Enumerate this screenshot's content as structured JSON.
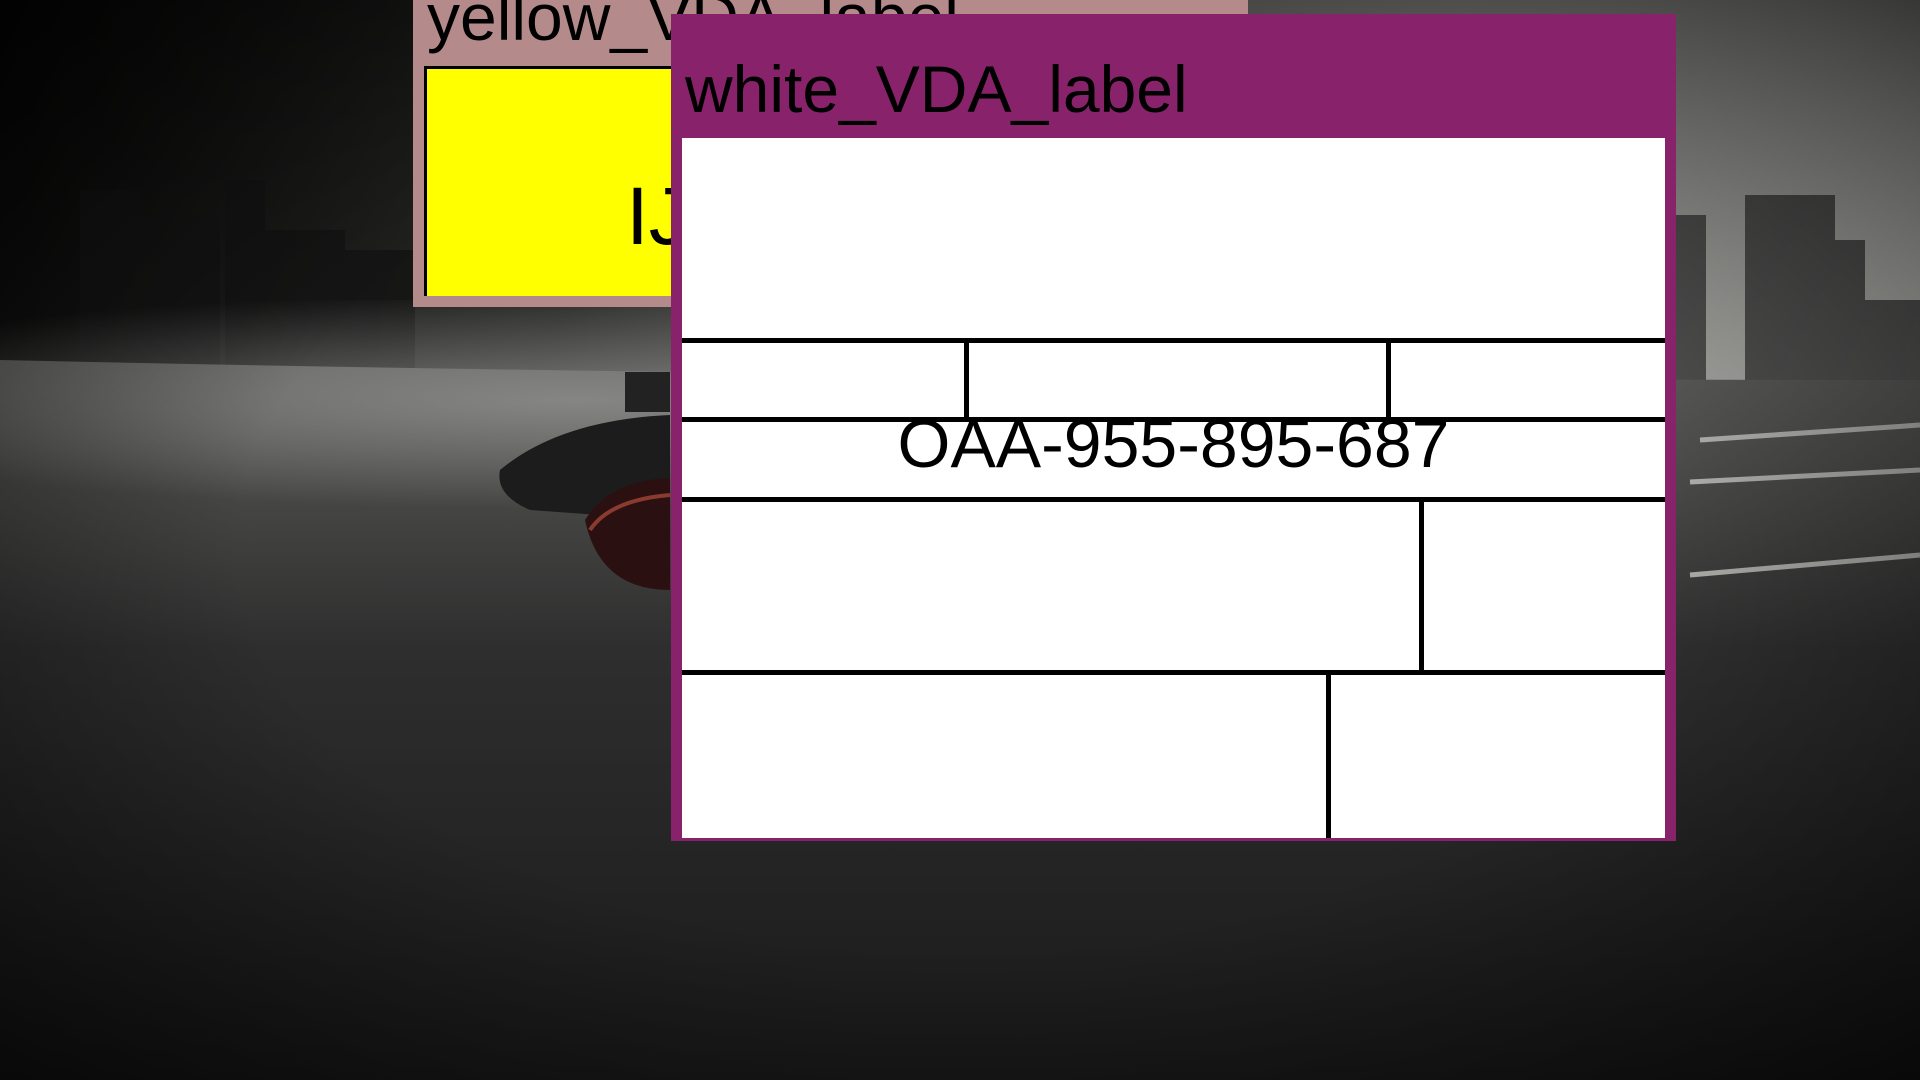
{
  "desktop": {
    "background_description_colors": {
      "sky": "#9a9a96",
      "ground": "#2b2b2b"
    }
  },
  "windows": {
    "yellow": {
      "title": "yellow_VDA_label",
      "frame_color": "#b58a8b",
      "content_color": "#ffff00",
      "code_text": "IJ"
    },
    "white": {
      "title": "white_VDA_label",
      "frame_color": "#88226b",
      "content_color": "#ffffff",
      "code_text": "OAA-955-895-687"
    }
  }
}
